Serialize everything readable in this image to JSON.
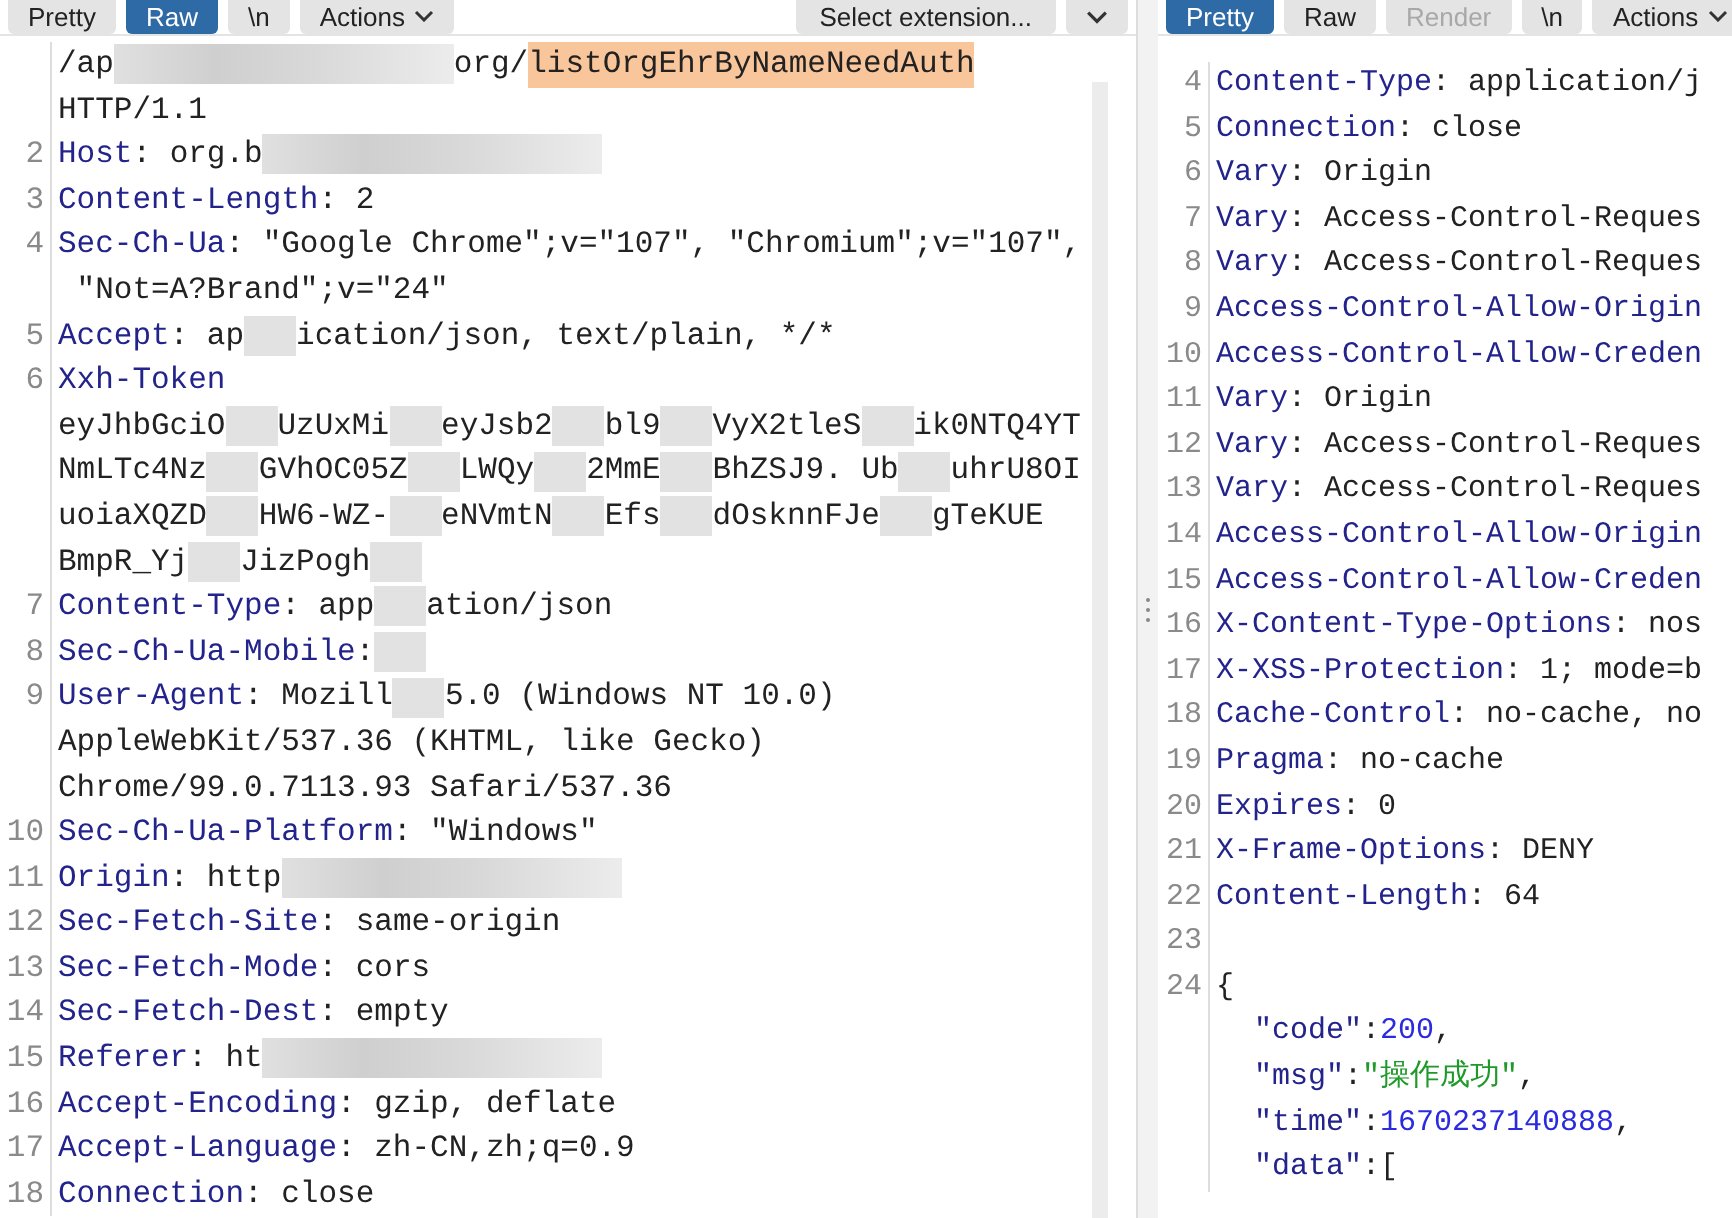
{
  "request": {
    "toolbar": {
      "buttons": [
        {
          "label": "Pretty",
          "selected": false,
          "disabled": false
        },
        {
          "label": "Raw",
          "selected": true,
          "disabled": false
        },
        {
          "label": "\\n",
          "selected": false,
          "disabled": false
        },
        {
          "label": "Actions",
          "selected": false,
          "disabled": false,
          "dropdown": true
        }
      ],
      "extension_select": "Select extension..."
    },
    "lines": [
      {
        "segments": [
          {
            "kind": "text",
            "text": "/ap"
          },
          {
            "kind": "redacted"
          },
          {
            "kind": "text",
            "text": "org/"
          },
          {
            "kind": "highlight",
            "text": "listOrgEhrByNameNeedAuth"
          }
        ]
      },
      {
        "segments": [
          {
            "kind": "text",
            "text": "HTTP/1.1"
          }
        ]
      },
      {
        "number": "2",
        "segments": [
          {
            "kind": "key",
            "text": "Host"
          },
          {
            "kind": "text",
            "text": ": org.b"
          },
          {
            "kind": "redacted"
          }
        ]
      },
      {
        "number": "3",
        "segments": [
          {
            "kind": "key",
            "text": "Content-Length"
          },
          {
            "kind": "text",
            "text": ": 2"
          }
        ]
      },
      {
        "number": "4",
        "segments": [
          {
            "kind": "key",
            "text": "Sec-Ch-Ua"
          },
          {
            "kind": "text",
            "text": ": \"Google Chrome\";v=\"107\", \"Chromium\";v=\"107\","
          }
        ]
      },
      {
        "segments": [
          {
            "kind": "text",
            "text": " \"Not=A?Brand\";v=\"24\""
          }
        ]
      },
      {
        "number": "5",
        "segments": [
          {
            "kind": "key",
            "text": "Accept"
          },
          {
            "kind": "text",
            "text": ": ap"
          },
          {
            "kind": "smudge"
          },
          {
            "kind": "text",
            "text": "ication/json, text/plain, */*"
          }
        ]
      },
      {
        "number": "6",
        "segments": [
          {
            "kind": "key",
            "text": "Xxh-Token"
          }
        ]
      },
      {
        "segments": [
          {
            "kind": "text",
            "text": "eyJhbGciO"
          },
          {
            "kind": "smudge"
          },
          {
            "kind": "text",
            "text": "UzUxMi"
          },
          {
            "kind": "smudge"
          },
          {
            "kind": "text",
            "text": "eyJsb2"
          },
          {
            "kind": "smudge"
          },
          {
            "kind": "text",
            "text": "bl9"
          },
          {
            "kind": "smudge"
          },
          {
            "kind": "text",
            "text": "VyX2tleS"
          },
          {
            "kind": "smudge"
          },
          {
            "kind": "text",
            "text": "ik0NTQ4YT"
          }
        ]
      },
      {
        "segments": [
          {
            "kind": "text",
            "text": "NmLTc4Nz"
          },
          {
            "kind": "smudge"
          },
          {
            "kind": "text",
            "text": "GVhOC05Z"
          },
          {
            "kind": "smudge"
          },
          {
            "kind": "text",
            "text": "LWQy"
          },
          {
            "kind": "smudge"
          },
          {
            "kind": "text",
            "text": "2MmE"
          },
          {
            "kind": "smudge"
          },
          {
            "kind": "text",
            "text": "BhZSJ9. Ub"
          },
          {
            "kind": "smudge"
          },
          {
            "kind": "text",
            "text": "uhrU8OI"
          }
        ]
      },
      {
        "segments": [
          {
            "kind": "text",
            "text": "uoiaXQZD"
          },
          {
            "kind": "smudge"
          },
          {
            "kind": "text",
            "text": "HW6-WZ-"
          },
          {
            "kind": "smudge"
          },
          {
            "kind": "text",
            "text": "eNVmtN"
          },
          {
            "kind": "smudge"
          },
          {
            "kind": "text",
            "text": "Efs"
          },
          {
            "kind": "smudge"
          },
          {
            "kind": "text",
            "text": "dOsknnFJe"
          },
          {
            "kind": "smudge"
          },
          {
            "kind": "text",
            "text": "gTeKUE"
          }
        ]
      },
      {
        "segments": [
          {
            "kind": "text",
            "text": "BmpR_Yj"
          },
          {
            "kind": "smudge"
          },
          {
            "kind": "text",
            "text": "JizPogh"
          },
          {
            "kind": "smudge"
          }
        ]
      },
      {
        "number": "7",
        "segments": [
          {
            "kind": "key",
            "text": "Content-Type"
          },
          {
            "kind": "text",
            "text": ": app"
          },
          {
            "kind": "smudge"
          },
          {
            "kind": "text",
            "text": "ation/json"
          }
        ]
      },
      {
        "number": "8",
        "segments": [
          {
            "kind": "key",
            "text": "Sec-Ch-Ua-Mobile"
          },
          {
            "kind": "text",
            "text": ":"
          },
          {
            "kind": "smudge"
          }
        ]
      },
      {
        "number": "9",
        "segments": [
          {
            "kind": "key",
            "text": "User-Agent"
          },
          {
            "kind": "text",
            "text": ": Mozill"
          },
          {
            "kind": "smudge"
          },
          {
            "kind": "text",
            "text": "5.0 (Windows NT 10.0)"
          }
        ]
      },
      {
        "segments": [
          {
            "kind": "text",
            "text": "AppleWebKit/537.36 (KHTML, like Gecko)"
          }
        ]
      },
      {
        "segments": [
          {
            "kind": "text",
            "text": "Chrome/99.0.7113.93 Safari/537.36"
          }
        ]
      },
      {
        "number": "10",
        "segments": [
          {
            "kind": "key",
            "text": "Sec-Ch-Ua-Platform"
          },
          {
            "kind": "text",
            "text": ": \"Windows\""
          }
        ]
      },
      {
        "number": "11",
        "segments": [
          {
            "kind": "key",
            "text": "Origin"
          },
          {
            "kind": "text",
            "text": ": http"
          },
          {
            "kind": "redacted"
          }
        ]
      },
      {
        "number": "12",
        "segments": [
          {
            "kind": "key",
            "text": "Sec-Fetch-Site"
          },
          {
            "kind": "text",
            "text": ": same-origin"
          }
        ]
      },
      {
        "number": "13",
        "segments": [
          {
            "kind": "key",
            "text": "Sec-Fetch-Mode"
          },
          {
            "kind": "text",
            "text": ": cors"
          }
        ]
      },
      {
        "number": "14",
        "segments": [
          {
            "kind": "key",
            "text": "Sec-Fetch-Dest"
          },
          {
            "kind": "text",
            "text": ": empty"
          }
        ]
      },
      {
        "number": "15",
        "segments": [
          {
            "kind": "key",
            "text": "Referer"
          },
          {
            "kind": "text",
            "text": ": ht"
          },
          {
            "kind": "redacted"
          }
        ]
      },
      {
        "number": "16",
        "segments": [
          {
            "kind": "key",
            "text": "Accept-Encoding"
          },
          {
            "kind": "text",
            "text": ": gzip, deflate"
          }
        ]
      },
      {
        "number": "17",
        "segments": [
          {
            "kind": "key",
            "text": "Accept-Language"
          },
          {
            "kind": "text",
            "text": ": zh-CN,zh;q=0.9"
          }
        ]
      },
      {
        "number": "18",
        "segments": [
          {
            "kind": "key",
            "text": "Connection"
          },
          {
            "kind": "text",
            "text": ": close"
          }
        ]
      }
    ]
  },
  "response": {
    "toolbar": {
      "buttons": [
        {
          "label": "Pretty",
          "selected": true,
          "disabled": false
        },
        {
          "label": "Raw",
          "selected": false,
          "disabled": false
        },
        {
          "label": "Render",
          "selected": false,
          "disabled": true
        },
        {
          "label": "\\n",
          "selected": false,
          "disabled": false
        },
        {
          "label": "Actions",
          "selected": false,
          "disabled": false,
          "dropdown": true
        }
      ]
    },
    "lines": [
      {
        "number": "4",
        "segments": [
          {
            "kind": "key",
            "text": "Content-Type"
          },
          {
            "kind": "text",
            "text": ": application/j"
          }
        ]
      },
      {
        "number": "5",
        "segments": [
          {
            "kind": "key",
            "text": "Connection"
          },
          {
            "kind": "text",
            "text": ": close"
          }
        ]
      },
      {
        "number": "6",
        "segments": [
          {
            "kind": "key",
            "text": "Vary"
          },
          {
            "kind": "text",
            "text": ": Origin"
          }
        ]
      },
      {
        "number": "7",
        "segments": [
          {
            "kind": "key",
            "text": "Vary"
          },
          {
            "kind": "text",
            "text": ": Access-Control-Reques"
          }
        ]
      },
      {
        "number": "8",
        "segments": [
          {
            "kind": "key",
            "text": "Vary"
          },
          {
            "kind": "text",
            "text": ": Access-Control-Reques"
          }
        ]
      },
      {
        "number": "9",
        "segments": [
          {
            "kind": "key",
            "text": "Access-Control-Allow-Origin"
          }
        ]
      },
      {
        "number": "10",
        "segments": [
          {
            "kind": "key",
            "text": "Access-Control-Allow-Creden"
          }
        ]
      },
      {
        "number": "11",
        "segments": [
          {
            "kind": "key",
            "text": "Vary"
          },
          {
            "kind": "text",
            "text": ": Origin"
          }
        ]
      },
      {
        "number": "12",
        "segments": [
          {
            "kind": "key",
            "text": "Vary"
          },
          {
            "kind": "text",
            "text": ": Access-Control-Reques"
          }
        ]
      },
      {
        "number": "13",
        "segments": [
          {
            "kind": "key",
            "text": "Vary"
          },
          {
            "kind": "text",
            "text": ": Access-Control-Reques"
          }
        ]
      },
      {
        "number": "14",
        "segments": [
          {
            "kind": "key",
            "text": "Access-Control-Allow-Origin"
          }
        ]
      },
      {
        "number": "15",
        "segments": [
          {
            "kind": "key",
            "text": "Access-Control-Allow-Creden"
          }
        ]
      },
      {
        "number": "16",
        "segments": [
          {
            "kind": "key",
            "text": "X-Content-Type-Options"
          },
          {
            "kind": "text",
            "text": ": nos"
          }
        ]
      },
      {
        "number": "17",
        "segments": [
          {
            "kind": "key",
            "text": "X-XSS-Protection"
          },
          {
            "kind": "text",
            "text": ": 1; mode=b"
          }
        ]
      },
      {
        "number": "18",
        "segments": [
          {
            "kind": "key",
            "text": "Cache-Control"
          },
          {
            "kind": "text",
            "text": ": no-cache, no"
          }
        ]
      },
      {
        "number": "19",
        "segments": [
          {
            "kind": "key",
            "text": "Pragma"
          },
          {
            "kind": "text",
            "text": ": no-cache"
          }
        ]
      },
      {
        "number": "20",
        "segments": [
          {
            "kind": "key",
            "text": "Expires"
          },
          {
            "kind": "text",
            "text": ": 0"
          }
        ]
      },
      {
        "number": "21",
        "segments": [
          {
            "kind": "key",
            "text": "X-Frame-Options"
          },
          {
            "kind": "text",
            "text": ": DENY"
          }
        ]
      },
      {
        "number": "22",
        "segments": [
          {
            "kind": "key",
            "text": "Content-Length"
          },
          {
            "kind": "text",
            "text": ": 64"
          }
        ]
      },
      {
        "number": "23"
      },
      {
        "number": "24",
        "segments": [
          {
            "kind": "punct",
            "text": "{"
          }
        ]
      },
      {
        "segments": [
          {
            "kind": "json-key",
            "text": "\"code\""
          },
          {
            "kind": "punct",
            "text": ":"
          },
          {
            "kind": "json-number",
            "text": "200"
          },
          {
            "kind": "punct",
            "text": ","
          }
        ]
      },
      {
        "segments": [
          {
            "kind": "json-key",
            "text": "\"msg\""
          },
          {
            "kind": "punct",
            "text": ":"
          },
          {
            "kind": "json-string",
            "text": "\"操作成功\""
          },
          {
            "kind": "punct",
            "text": ","
          }
        ]
      },
      {
        "segments": [
          {
            "kind": "json-key",
            "text": "\"time\""
          },
          {
            "kind": "punct",
            "text": ":"
          },
          {
            "kind": "json-number",
            "text": "1670237140888"
          },
          {
            "kind": "punct",
            "text": ","
          }
        ]
      },
      {
        "segments": [
          {
            "kind": "json-key",
            "text": "\"data\""
          },
          {
            "kind": "punct",
            "text": ":["
          }
        ]
      }
    ]
  }
}
